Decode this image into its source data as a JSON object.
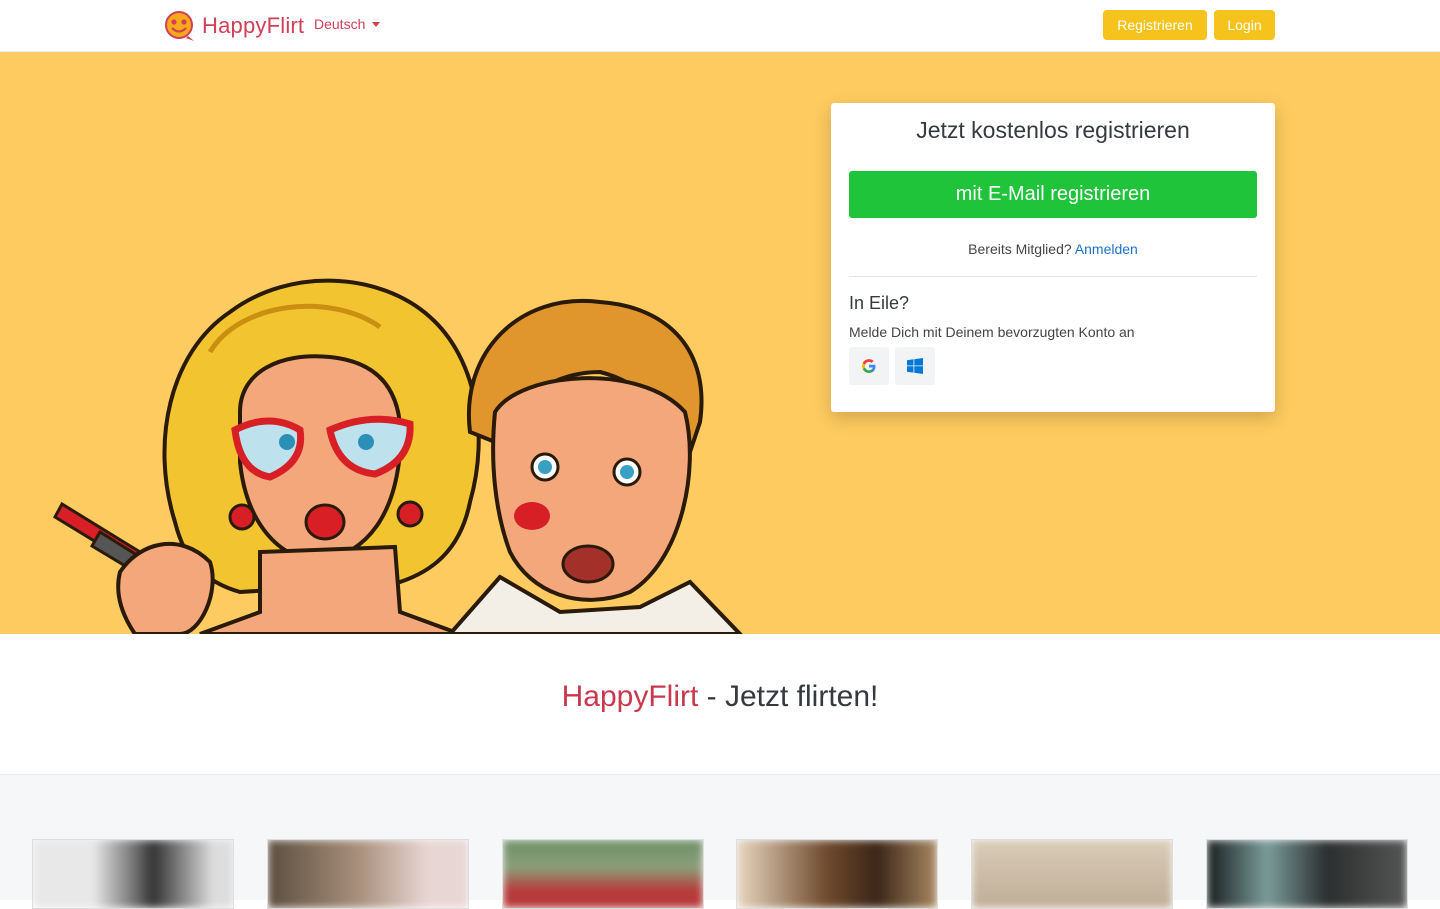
{
  "nav": {
    "brand": "HappyFlirt",
    "language": "Deutsch",
    "register_label": "Registrieren",
    "login_label": "Login"
  },
  "signup_card": {
    "title": "Jetzt kostenlos registrieren",
    "email_button": "mit E-Mail registrieren",
    "member_prefix": "Bereits Mitglied?",
    "member_link": "Anmelden",
    "hurry_title": "In Eile?",
    "hurry_text": "Melde Dich mit Deinem bevorzugten Konto an",
    "social": [
      "google-icon",
      "windows-icon"
    ]
  },
  "tagline": {
    "brand": "HappyFlirt",
    "rest": " - Jetzt flirten!"
  },
  "colors": {
    "accent": "#f6c21c",
    "brand": "#d13f57",
    "hero_bg": "#fdcb5f",
    "cta_green": "#1fc43a",
    "link": "#1a73c9"
  },
  "profiles": [
    {
      "name": "profile-1"
    },
    {
      "name": "profile-2"
    },
    {
      "name": "profile-3"
    },
    {
      "name": "profile-4"
    },
    {
      "name": "profile-5"
    },
    {
      "name": "profile-6"
    }
  ]
}
